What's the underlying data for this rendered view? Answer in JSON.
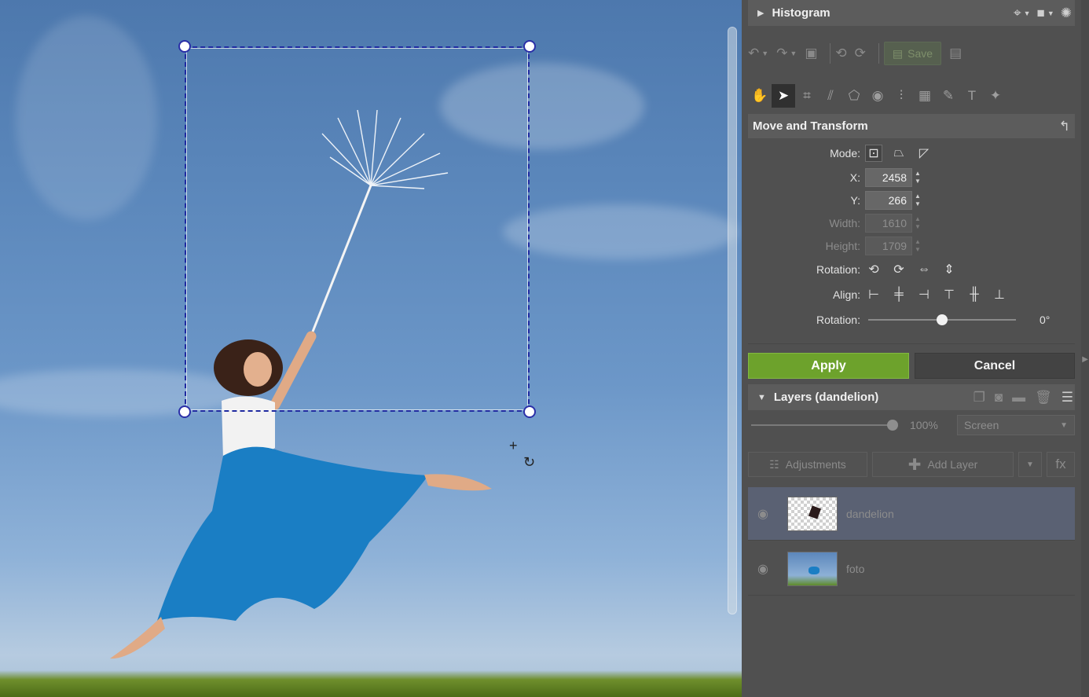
{
  "histogram": {
    "title": "Histogram"
  },
  "toolbar": {
    "save_label": "Save"
  },
  "tools": [
    "hand-tool",
    "select-tool",
    "crop-tool",
    "straighten-tool",
    "transform-tool",
    "eye-tool",
    "align-tool",
    "grid-tool",
    "brush-tool",
    "text-tool",
    "effects-tool"
  ],
  "move_transform": {
    "title": "Move and Transform",
    "mode_label": "Mode:",
    "x_label": "X:",
    "x_value": "2458",
    "y_label": "Y:",
    "y_value": "266",
    "width_label": "Width:",
    "width_value": "1610",
    "height_label": "Height:",
    "height_value": "1709",
    "rotation_label": "Rotation:",
    "align_label": "Align:",
    "rotation_slider_label": "Rotation:",
    "rotation_value": "0°",
    "rotation_fraction": 0.5
  },
  "actions": {
    "apply_label": "Apply",
    "cancel_label": "Cancel"
  },
  "layers": {
    "title": "Layers (dandelion)",
    "opacity": "100%",
    "opacity_fraction": 1.0,
    "blend_mode": "Screen",
    "adjustments_label": "Adjustments",
    "add_layer_label": "Add Layer",
    "fx_label": "fx",
    "items": [
      {
        "name": "dandelion",
        "selected": true
      },
      {
        "name": "foto",
        "selected": false
      }
    ]
  },
  "colors": {
    "accent_apply": "#6da22c",
    "selection_border": "#1f2aa0",
    "panel_bg": "#505050"
  }
}
